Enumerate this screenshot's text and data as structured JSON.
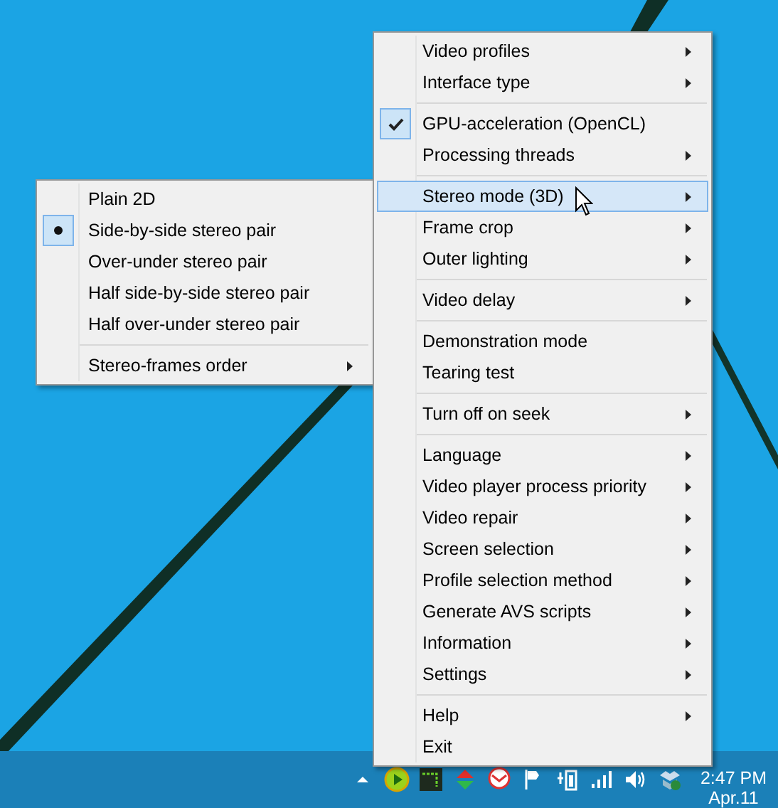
{
  "menu": {
    "items": [
      {
        "kind": "item",
        "label": "Video profiles",
        "submenu": true,
        "checked": false,
        "selected": false
      },
      {
        "kind": "item",
        "label": "Interface type",
        "submenu": true,
        "checked": false,
        "selected": false
      },
      {
        "kind": "separator"
      },
      {
        "kind": "item",
        "label": "GPU-acceleration (OpenCL)",
        "submenu": false,
        "checked": true,
        "selected": false
      },
      {
        "kind": "item",
        "label": "Processing threads",
        "submenu": true,
        "checked": false,
        "selected": false
      },
      {
        "kind": "separator"
      },
      {
        "kind": "item",
        "label": "Stereo mode (3D)",
        "submenu": true,
        "checked": false,
        "selected": true
      },
      {
        "kind": "item",
        "label": "Frame crop",
        "submenu": true,
        "checked": false,
        "selected": false
      },
      {
        "kind": "item",
        "label": "Outer lighting",
        "submenu": true,
        "checked": false,
        "selected": false
      },
      {
        "kind": "separator"
      },
      {
        "kind": "item",
        "label": "Video delay",
        "submenu": true,
        "checked": false,
        "selected": false
      },
      {
        "kind": "separator"
      },
      {
        "kind": "item",
        "label": "Demonstration mode",
        "submenu": false,
        "checked": false,
        "selected": false
      },
      {
        "kind": "item",
        "label": "Tearing test",
        "submenu": false,
        "checked": false,
        "selected": false
      },
      {
        "kind": "separator"
      },
      {
        "kind": "item",
        "label": "Turn off on seek",
        "submenu": true,
        "checked": false,
        "selected": false
      },
      {
        "kind": "separator"
      },
      {
        "kind": "item",
        "label": "Language",
        "submenu": true,
        "checked": false,
        "selected": false
      },
      {
        "kind": "item",
        "label": "Video player process priority",
        "submenu": true,
        "checked": false,
        "selected": false
      },
      {
        "kind": "item",
        "label": "Video repair",
        "submenu": true,
        "checked": false,
        "selected": false
      },
      {
        "kind": "item",
        "label": "Screen selection",
        "submenu": true,
        "checked": false,
        "selected": false
      },
      {
        "kind": "item",
        "label": "Profile selection method",
        "submenu": true,
        "checked": false,
        "selected": false
      },
      {
        "kind": "item",
        "label": "Generate AVS scripts",
        "submenu": true,
        "checked": false,
        "selected": false
      },
      {
        "kind": "item",
        "label": "Information",
        "submenu": true,
        "checked": false,
        "selected": false
      },
      {
        "kind": "item",
        "label": "Settings",
        "submenu": true,
        "checked": false,
        "selected": false
      },
      {
        "kind": "separator"
      },
      {
        "kind": "item",
        "label": "Help",
        "submenu": true,
        "checked": false,
        "selected": false
      },
      {
        "kind": "item",
        "label": "Exit",
        "submenu": false,
        "checked": false,
        "selected": false
      }
    ]
  },
  "submenu": {
    "items": [
      {
        "kind": "radio",
        "label": "Plain 2D",
        "selected": false
      },
      {
        "kind": "radio",
        "label": "Side-by-side stereo pair",
        "selected": true
      },
      {
        "kind": "radio",
        "label": "Over-under stereo pair",
        "selected": false
      },
      {
        "kind": "radio",
        "label": "Half side-by-side stereo pair",
        "selected": false
      },
      {
        "kind": "radio",
        "label": "Half over-under stereo pair",
        "selected": false
      },
      {
        "kind": "separator"
      },
      {
        "kind": "item",
        "label": "Stereo-frames order",
        "submenu": true
      }
    ]
  },
  "clock": {
    "time": "2:47 PM",
    "date": "Apr.11"
  }
}
